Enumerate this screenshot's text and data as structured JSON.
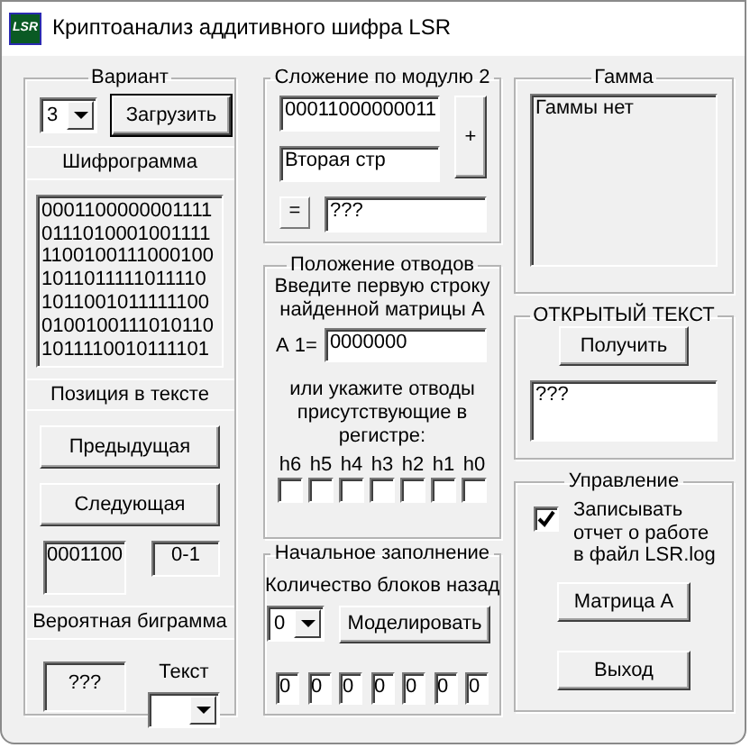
{
  "window": {
    "title": "Криптоанализ аддитивного шифра LSR",
    "icon_text": "LSR"
  },
  "variant": {
    "title": "Вариант",
    "value": "3",
    "load_button": "Загрузить"
  },
  "cipher": {
    "title": "Шифрограмма",
    "lines": [
      "0001100000001111",
      "0111010001001111",
      "1100100111000100",
      "1011011111011110",
      "1011001011111100",
      "0100100111010110",
      "1011110010111101"
    ]
  },
  "position": {
    "title": "Позиция в тексте",
    "prev_button": "Предыдущая",
    "next_button": "Следующая",
    "bits": "0001100",
    "range": "0-1"
  },
  "bigram": {
    "title": "Вероятная биграмма",
    "value": "???",
    "text_label": "Текст"
  },
  "xor": {
    "title": "Сложение по модулю 2",
    "first": "00011000000011",
    "second": "Вторая стр",
    "plus": "+",
    "equals": "=",
    "result": "???"
  },
  "taps": {
    "title": "Положение отводов",
    "prompt": [
      "Введите первую строку",
      "найденной матрицы А"
    ],
    "a1_label": "А 1=",
    "a1_value": "0000000",
    "hint": [
      "или укажите отводы",
      "присутствующие в",
      "регистре:"
    ],
    "bits": [
      {
        "label": "h6",
        "checked": false
      },
      {
        "label": "h5",
        "checked": false
      },
      {
        "label": "h4",
        "checked": false
      },
      {
        "label": "h3",
        "checked": false
      },
      {
        "label": "h2",
        "checked": false
      },
      {
        "label": "h1",
        "checked": false
      },
      {
        "label": "h0",
        "checked": false
      }
    ]
  },
  "initial": {
    "title": "Начальное заполнение",
    "blocks_label": "Количество блоков назад",
    "blocks_value": "0",
    "model_button": "Моделировать",
    "cells": [
      "0",
      "0",
      "0",
      "0",
      "0",
      "0",
      "0"
    ]
  },
  "gamma": {
    "title": "Гамма",
    "lines": [
      "Гаммы нет"
    ]
  },
  "plaintext": {
    "title": "ОТКРЫТЫЙ ТЕКСТ",
    "get_button": "Получить",
    "value": "???"
  },
  "control": {
    "title": "Управление",
    "log": {
      "label": [
        "Записывать",
        "отчет о работе",
        "в файл LSR.log"
      ],
      "checked": true
    },
    "matrix_button": "Матрица А",
    "exit_button": "Выход"
  }
}
